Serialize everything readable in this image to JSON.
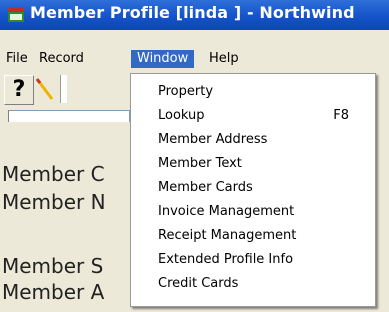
{
  "window": {
    "title": "Member Profile [linda   ] - Northwind"
  },
  "menubar": {
    "items": [
      {
        "label": "File"
      },
      {
        "label": "Record"
      },
      {
        "label": "Window"
      },
      {
        "label": "Help"
      }
    ],
    "active": "Window"
  },
  "toolbar": {
    "help_glyph": "?"
  },
  "fields": {
    "labels": [
      {
        "text": "Member C"
      },
      {
        "text": "Member N"
      },
      {
        "text": "Member S"
      },
      {
        "text": "Member A"
      }
    ]
  },
  "window_menu": {
    "items": [
      {
        "label": "Property",
        "shortcut": ""
      },
      {
        "label": "Lookup",
        "shortcut": "F8"
      },
      {
        "label": "Member Address",
        "shortcut": ""
      },
      {
        "label": "Member Text",
        "shortcut": ""
      },
      {
        "label": "Member Cards",
        "shortcut": ""
      },
      {
        "label": "Invoice Management",
        "shortcut": ""
      },
      {
        "label": "Receipt Management",
        "shortcut": ""
      },
      {
        "label": "Extended Profile Info",
        "shortcut": ""
      },
      {
        "label": "Credit Cards",
        "shortcut": ""
      }
    ]
  },
  "colors": {
    "title_bar": "#1453c9",
    "menu_highlight": "#316ac5"
  }
}
